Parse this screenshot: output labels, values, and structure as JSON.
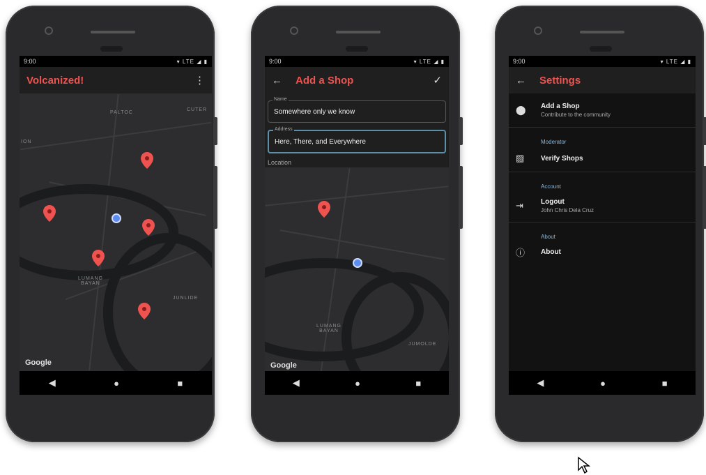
{
  "status": {
    "time": "9:00",
    "icons": "▾ LTE ◢ ▮"
  },
  "phone1": {
    "title": "Volcanized!",
    "overflow_icon": "more-vert-icon",
    "map_labels": [
      "PALTOC",
      "CUTER",
      "ION",
      "LUMANG BAYAN",
      "JUNLIDE"
    ],
    "google": "Google"
  },
  "phone2": {
    "title": "Add a Shop",
    "back_icon": "arrow-left-icon",
    "confirm_icon": "check-icon",
    "name_label": "Name",
    "name_value": "Somewhere only we know",
    "address_label": "Address",
    "address_value": "Here, There, and Everywhere",
    "location_label": "Location",
    "map_labels": [
      "LUMANG BAYAN",
      "JUMOLDE"
    ],
    "google": "Google"
  },
  "phone3": {
    "title": "Settings",
    "back_icon": "arrow-left-icon",
    "add_shop_title": "Add a Shop",
    "add_shop_sub": "Contribute to the community",
    "moderator_header": "Moderator",
    "verify_title": "Verify Shops",
    "account_header": "Account",
    "logout_title": "Logout",
    "logout_sub": "John Chris Dela Cruz",
    "about_header": "About",
    "about_title": "About"
  },
  "nav": {
    "back": "◀",
    "home": "●",
    "recents": "■"
  },
  "colors": {
    "accent": "#ef5350",
    "section": "#8fb8d6",
    "focus": "#5d8fa8"
  }
}
